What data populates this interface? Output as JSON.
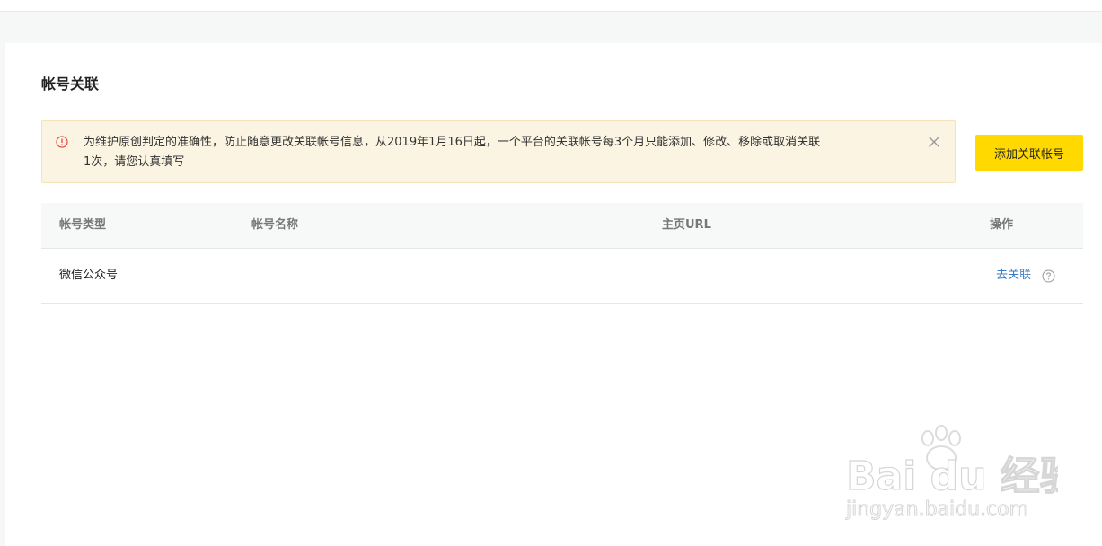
{
  "page": {
    "title": "帐号关联"
  },
  "notice": {
    "icon": "warning-circle-icon",
    "text_line1": "为维护原创判定的准确性，防止随意更改关联帐号信息，从2019年1月16日起，一个平台的关联帐号每3个月只能添加、修改、移除或取消关联",
    "text_line2": "1次，请您认真填写",
    "close_icon": "close-icon",
    "bg_color": "#fbf4e2",
    "icon_color": "#e0484b"
  },
  "toolbar": {
    "add_label": "添加关联帐号",
    "accent_color": "#ffd900"
  },
  "table": {
    "columns": [
      "帐号类型",
      "帐号名称",
      "主页URL",
      "操作"
    ],
    "rows": [
      {
        "type": "微信公众号",
        "name": "",
        "url": "",
        "action_label": "去关联",
        "action_icon": "question-circle-icon"
      }
    ]
  },
  "watermark": {
    "brand": "Bai du 经验",
    "url": "jingyan.baidu.com"
  }
}
